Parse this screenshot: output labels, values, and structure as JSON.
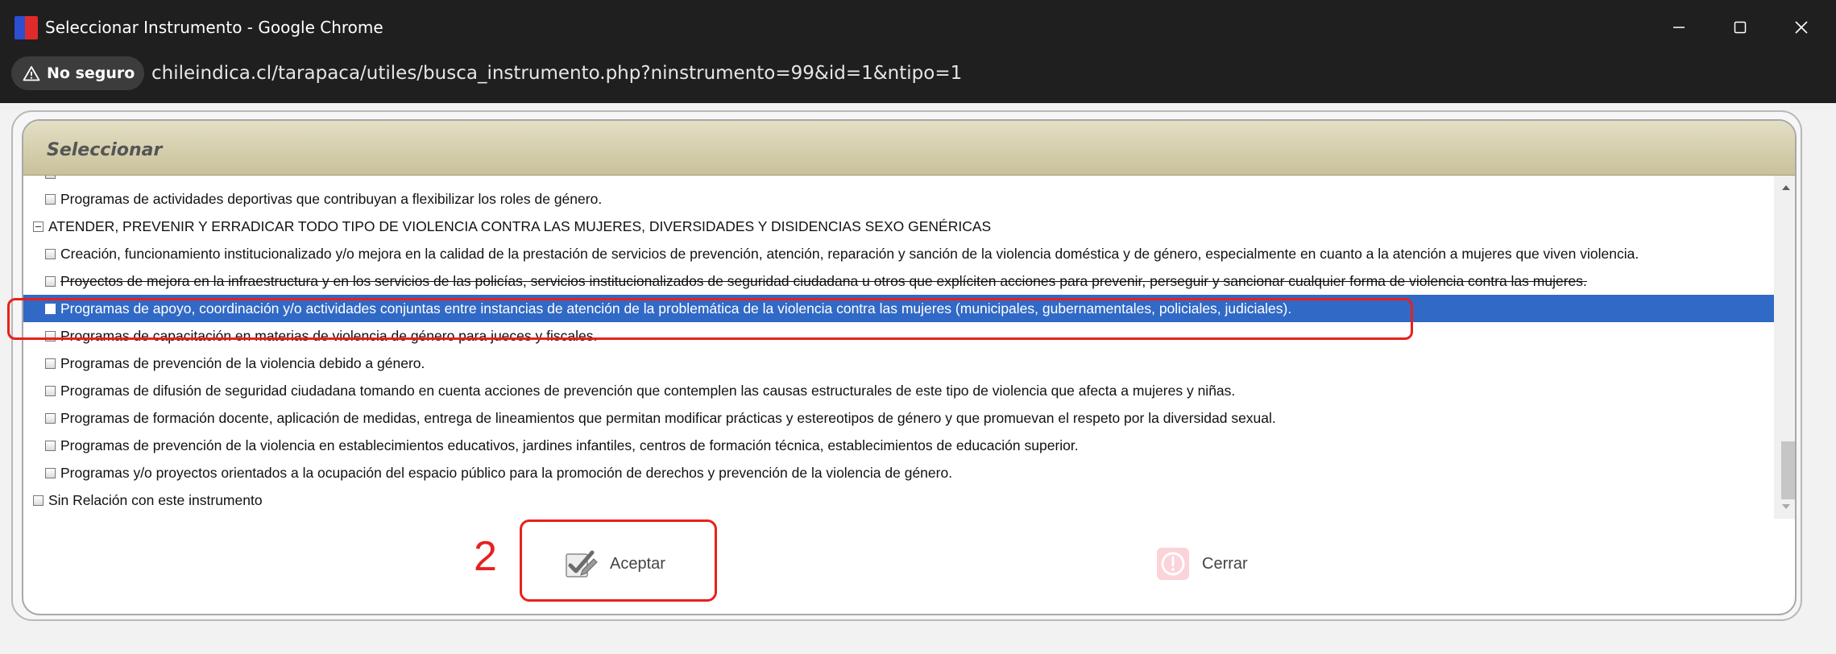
{
  "window": {
    "title": "Seleccionar Instrumento - Google Chrome",
    "controls": {
      "minimize": "minimize-icon",
      "maximize": "maximize-icon",
      "close": "close-icon"
    }
  },
  "address_bar": {
    "security_label": "No seguro",
    "url": "chileindica.cl/tarapaca/utiles/busca_instrumento.php?ninstrumento=99&id=1&ntipo=1"
  },
  "panel": {
    "title": "Seleccionar"
  },
  "tree": {
    "rows": [
      {
        "text": "Programas de actividades deportivas que contribuyan a flexibilizar los roles de género.",
        "level": 1,
        "selected": false
      },
      {
        "text": "ATENDER, PREVENIR Y ERRADICAR TODO TIPO DE VIOLENCIA CONTRA LAS MUJERES, DIVERSIDADES Y DISIDENCIAS SEXO GENÉRICAS",
        "level": 0,
        "expander": true,
        "selected": false
      },
      {
        "text": "Creación, funcionamiento institucionalizado y/o mejora en la calidad de la prestación de servicios de prevención, atención, reparación y sanción de la violencia doméstica y de género, especialmente en cuanto a la atención a mujeres que viven violencia.",
        "level": 1,
        "selected": false
      },
      {
        "text": "Proyectos de mejora en la infraestructura y en los servicios de las policías, servicios institucionalizados de seguridad ciudadana u otros que explíciten acciones para prevenir, perseguir y sancionar cualquier forma de violencia contra las mujeres.",
        "level": 1,
        "selected": false,
        "struck": true
      },
      {
        "text": "Programas de apoyo, coordinación y/o actividades conjuntas entre instancias de atención de la problemática de la violencia contra las mujeres (municipales, gubernamentales, policiales, judiciales).",
        "level": 1,
        "selected": true
      },
      {
        "text": "Programas de capacitación en materias de violencia de género para jueces y fiscales.",
        "level": 1,
        "selected": false
      },
      {
        "text": "Programas de prevención de la violencia debido a género.",
        "level": 1,
        "selected": false
      },
      {
        "text": "Programas de difusión de seguridad ciudadana tomando en cuenta acciones de prevención que contemplen las causas estructurales de este tipo de violencia que afecta a mujeres y niñas.",
        "level": 1,
        "selected": false
      },
      {
        "text": "Programas de formación docente, aplicación de medidas, entrega de lineamientos que permitan modificar prácticas y estereotipos de género y que promuevan el respeto por la diversidad sexual.",
        "level": 1,
        "selected": false
      },
      {
        "text": "Programas de prevención de la violencia en establecimientos educativos, jardines infantiles, centros de formación técnica, establecimientos de educación superior.",
        "level": 1,
        "selected": false
      },
      {
        "text": "Programas y/o proyectos orientados a la ocupación del espacio público para la promoción de derechos y prevención de la violencia de género.",
        "level": 1,
        "selected": false
      },
      {
        "text": "Sin Relación con este instrumento",
        "level": 0,
        "selected": false
      }
    ]
  },
  "buttons": {
    "accept_label": "Aceptar",
    "accept_icon": "edit-check-icon",
    "close_label": "Cerrar",
    "close_icon": "alert-circle-icon"
  },
  "annotation": {
    "step_number": "2",
    "color": "#e8201d"
  },
  "colors": {
    "selection": "#3169c6",
    "header": "#d6d0ad",
    "titlebar": "#1f1f1f"
  }
}
